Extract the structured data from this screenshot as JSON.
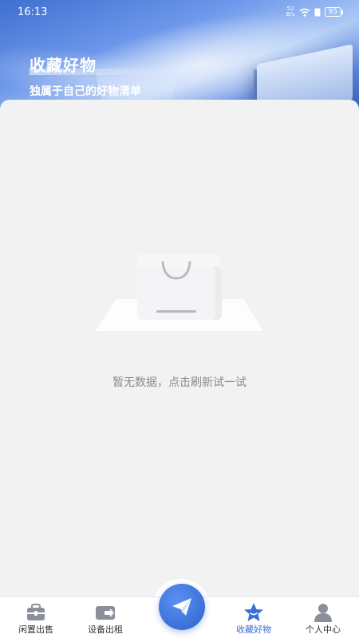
{
  "status_bar": {
    "time": "16:13",
    "net_speed_top": "52",
    "net_speed_bottom": "B/s",
    "battery": "95"
  },
  "header": {
    "title": "收藏好物",
    "subtitle": "独属于自己的好物清单"
  },
  "empty_state": {
    "message": "暂无数据，点击刷新试一试",
    "icon": "shopping-bag-icon"
  },
  "bottom_nav": {
    "items": [
      {
        "label": "闲置出售",
        "icon": "briefcase-icon"
      },
      {
        "label": "设备出租",
        "icon": "device-icon"
      },
      {
        "label": "收藏好物",
        "icon": "star-icon",
        "active": true
      },
      {
        "label": "个人中心",
        "icon": "user-icon"
      }
    ],
    "center_action_icon": "paper-plane-icon"
  },
  "colors": {
    "accent": "#3a6fd8",
    "header_blue": "#4a78d6",
    "inactive_icon": "#8a8f99"
  }
}
